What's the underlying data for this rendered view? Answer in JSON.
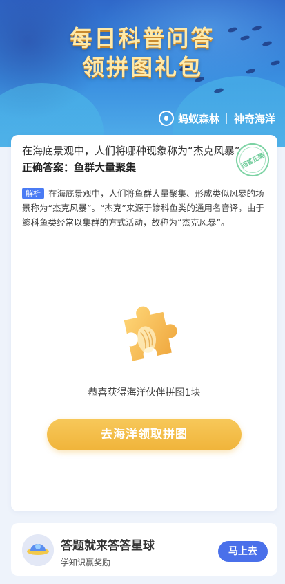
{
  "hero": {
    "title_line1": "每日科普问答",
    "title_line2": "领拼图礼包",
    "brand1": "蚂蚁森林",
    "brand2": "神奇海洋",
    "brand_icon": "ant-icon"
  },
  "quiz": {
    "question": "在海底景观中，人们将哪种现象称为“杰克风暴”",
    "answer": "正确答案：鱼群大量聚集",
    "stamp": "回答正确",
    "explain_tag": "解析",
    "explain_text": "在海底景观中，人们将鱼群大量聚集、形成类似风暴的场景称为“杰克风暴”。“杰克”来源于鲹科鱼类的通用名音译，由于鲹科鱼类经常以集群的方式活动，故称为“杰克风暴”。"
  },
  "reward": {
    "icon": "puzzle-piece-icon",
    "text": "恭喜获得海洋伙伴拼图1块",
    "button": "去海洋领取拼图"
  },
  "promo": {
    "title": "答题就来答答星球",
    "subtitle": "学知识赢奖励",
    "button": "马上去",
    "icon": "planet-icon"
  },
  "colors": {
    "accent_blue": "#4a70ea",
    "button_gold": "#f0b43a",
    "stamp_green": "#6ccb98"
  }
}
